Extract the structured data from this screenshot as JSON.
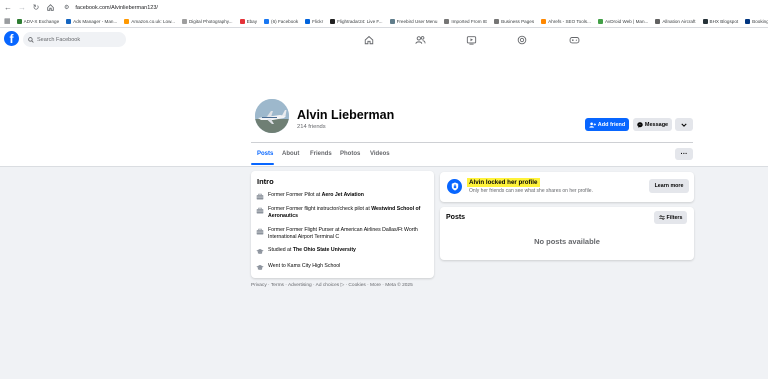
{
  "browser": {
    "url": "facebook.com/Alvinlieberman123/",
    "bookmarks": [
      {
        "label": "ADV-X Exchange",
        "color": "#2e7d32"
      },
      {
        "label": "Ads Manager - Man...",
        "color": "#1565c0"
      },
      {
        "label": "Amazon.co.uk: Low...",
        "color": "#ff9900"
      },
      {
        "label": "Digital Photography...",
        "color": "#9e9e9e"
      },
      {
        "label": "Ebay",
        "color": "#e53238"
      },
      {
        "label": "(6) Facebook",
        "color": "#1877f2"
      },
      {
        "label": "Flickr",
        "color": "#0063dc"
      },
      {
        "label": "Flightradar24: Live F...",
        "color": "#212121"
      },
      {
        "label": "Freebird User Menu",
        "color": "#607d8b"
      },
      {
        "label": "Imported From IE",
        "color": "#757575"
      },
      {
        "label": "Business Pages",
        "color": "#757575"
      },
      {
        "label": "Ahrefs - SEO Tools...",
        "color": "#ff8800"
      },
      {
        "label": "AvDroid Web | Man...",
        "color": "#43a047"
      },
      {
        "label": "Allnation Aircraft",
        "color": "#616161"
      },
      {
        "label": "BHX Blogspot",
        "color": "#263238"
      },
      {
        "label": "Booking A",
        "color": "#003580"
      }
    ]
  },
  "fb": {
    "search_placeholder": "Search Facebook"
  },
  "profile": {
    "name": "Alvin Lieberman",
    "friends": "214 friends",
    "add_friend": "Add friend",
    "message": "Message",
    "tabs": [
      "Posts",
      "About",
      "Friends",
      "Photos",
      "Videos"
    ],
    "more": "···"
  },
  "intro": {
    "title": "Intro",
    "items": [
      {
        "icon": "briefcase-icon",
        "prefix": "Former Former Pilot at ",
        "bold": "Aero Jet Aviation",
        "suffix": ""
      },
      {
        "icon": "briefcase-icon",
        "prefix": "Former Former flight instructor/check pilot at ",
        "bold": "Westwind School of Aeronautics",
        "suffix": ""
      },
      {
        "icon": "briefcase-icon",
        "prefix": "Former Former Flight Purser at American Airlines Dallas/Ft Worth International Airport Terminal C",
        "bold": "",
        "suffix": ""
      },
      {
        "icon": "graduation-cap-icon",
        "prefix": "Studied at ",
        "bold": "The Ohio State University",
        "suffix": ""
      },
      {
        "icon": "graduation-cap-icon",
        "prefix": "Went to Kams City High School",
        "bold": "",
        "suffix": ""
      }
    ]
  },
  "locked": {
    "title": "Alvin locked her profile",
    "subtitle": "Only her friends can see what she shares on her profile.",
    "learn_more": "Learn more"
  },
  "posts": {
    "title": "Posts",
    "filters": "Filters",
    "empty": "No posts available"
  },
  "footer": "Privacy · Terms · Advertising · Ad choices ▷ · Cookies · More · Meta © 2025"
}
